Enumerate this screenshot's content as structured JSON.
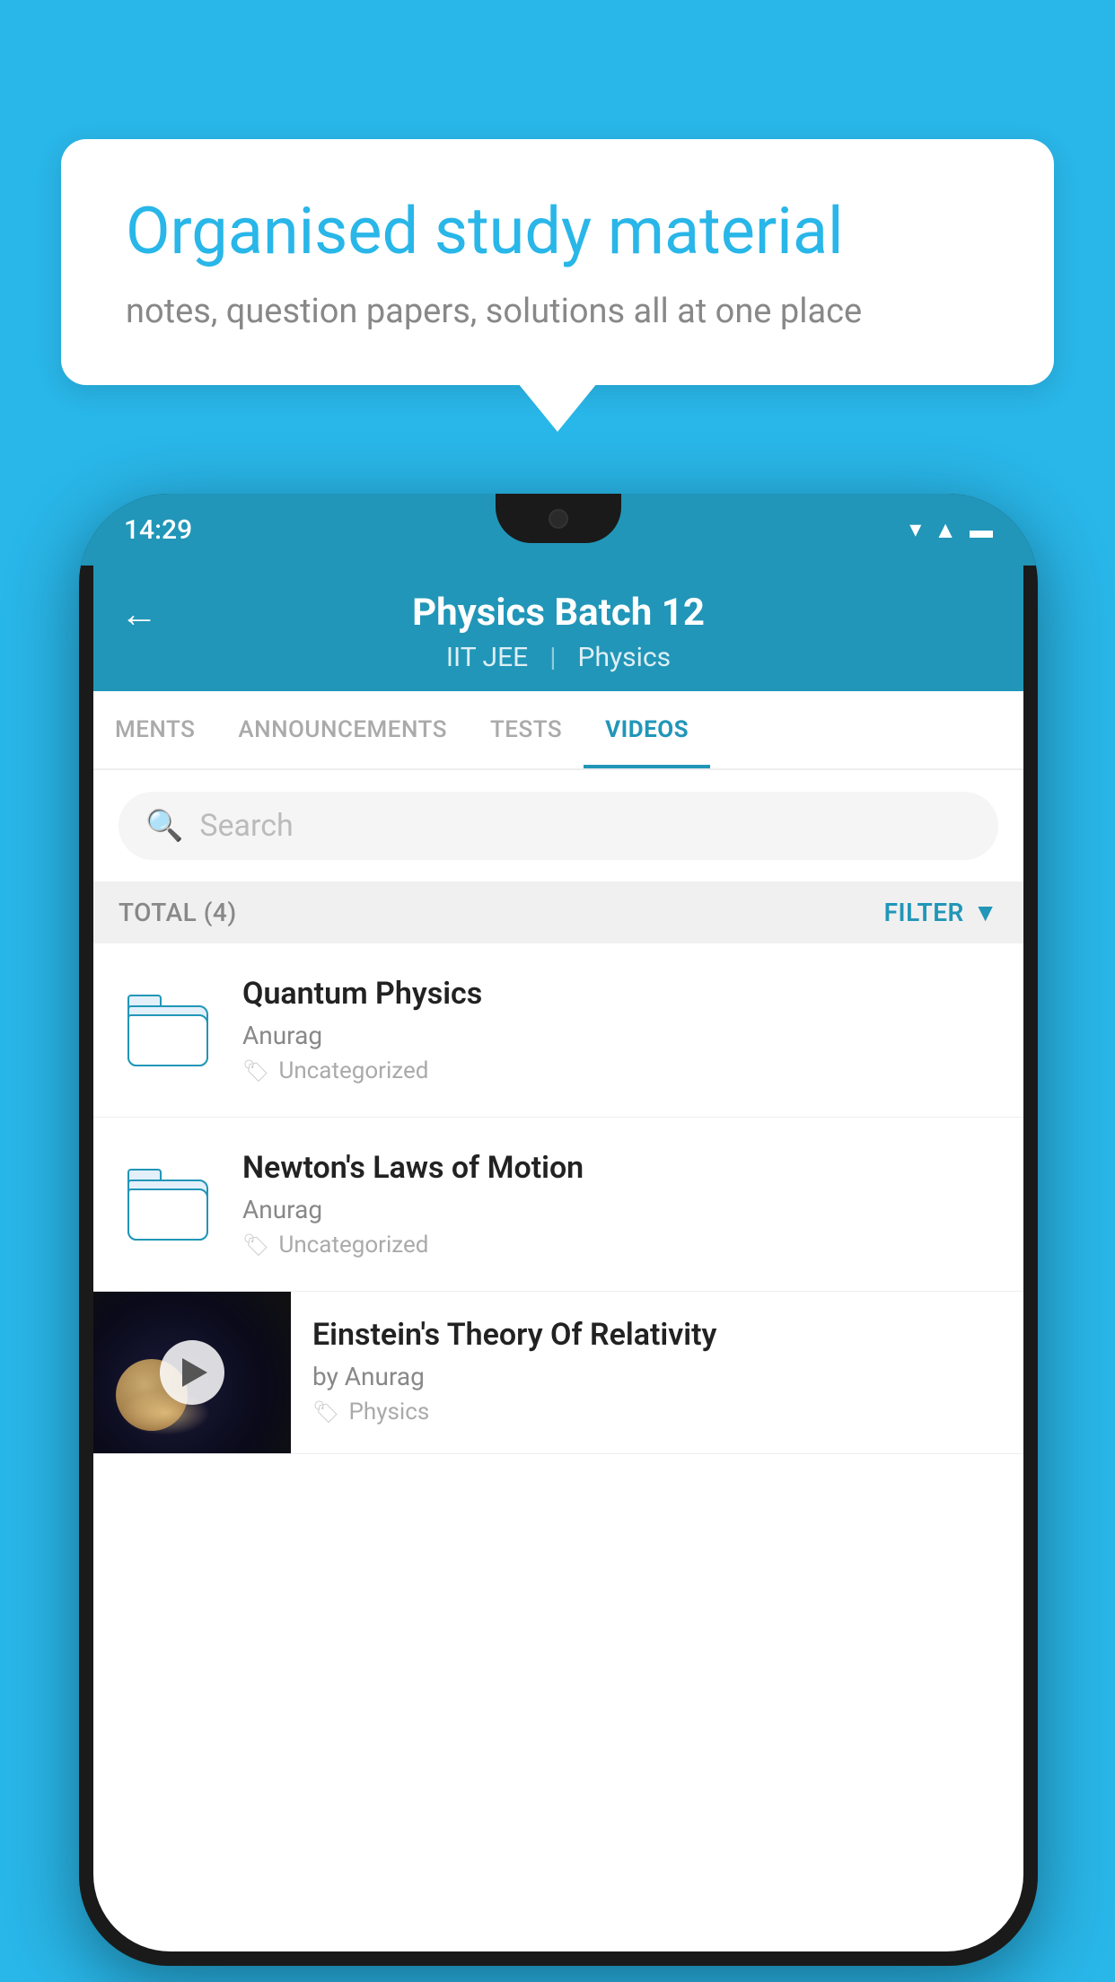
{
  "background_color": "#29b6e8",
  "speech_bubble": {
    "title": "Organised study material",
    "subtitle": "notes, question papers, solutions all at one place"
  },
  "phone": {
    "status_bar": {
      "time": "14:29",
      "icons": [
        "wifi",
        "signal",
        "battery"
      ]
    },
    "header": {
      "back_label": "←",
      "title": "Physics Batch 12",
      "tags": [
        "IIT JEE",
        "Physics"
      ]
    },
    "tabs": [
      {
        "label": "MENTS",
        "active": false
      },
      {
        "label": "ANNOUNCEMENTS",
        "active": false
      },
      {
        "label": "TESTS",
        "active": false
      },
      {
        "label": "VIDEOS",
        "active": true
      }
    ],
    "search": {
      "placeholder": "Search"
    },
    "filter": {
      "total_label": "TOTAL (4)",
      "filter_label": "FILTER"
    },
    "videos": [
      {
        "title": "Quantum Physics",
        "author": "Anurag",
        "tag": "Uncategorized",
        "type": "folder"
      },
      {
        "title": "Newton's Laws of Motion",
        "author": "Anurag",
        "tag": "Uncategorized",
        "type": "folder"
      },
      {
        "title": "Einstein's Theory Of Relativity",
        "author_prefix": "by",
        "author": "Anurag",
        "tag": "Physics",
        "type": "video"
      }
    ]
  }
}
